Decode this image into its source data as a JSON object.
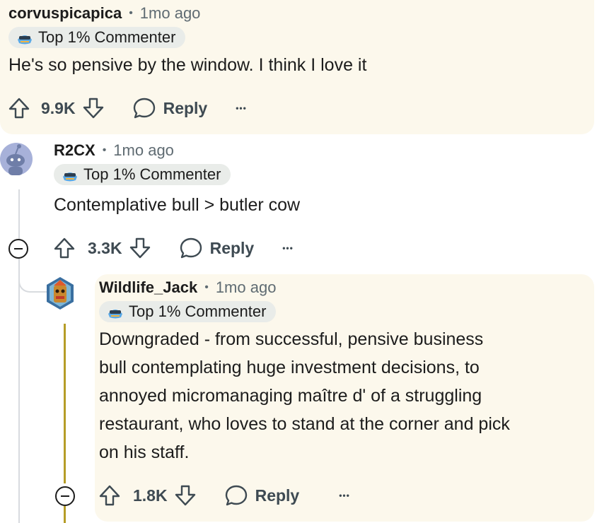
{
  "badge_label": "Top 1% Commenter",
  "comments": [
    {
      "username": "corvuspicapica",
      "separator": "•",
      "time": "1mo ago",
      "text": "He's so pensive by the window. I think I love it",
      "votes": "9.9K",
      "reply_label": "Reply",
      "more_label": "•••"
    },
    {
      "username": "R2CX",
      "separator": "•",
      "time": "1mo ago",
      "text": "Contemplative bull > butler cow",
      "votes": "3.3K",
      "reply_label": "Reply",
      "more_label": "•••"
    },
    {
      "username": "Wildlife_Jack",
      "separator": "•",
      "time": "1mo ago",
      "text_lines": [
        "Downgraded - from successful, pensive business",
        "bull contemplating huge investment decisions, to",
        "annoyed micromanaging maître d' of a struggling",
        "restaurant, who loves to stand at the corner and pick",
        "on his staff."
      ],
      "votes": "1.8K",
      "reply_label": "Reply",
      "more_label": "•••"
    }
  ],
  "colors": {
    "highlight": "#fcf8ec",
    "badge_bg": "#e9ece9",
    "thread_line": "#d8dbdf",
    "gold_line": "#b69d28"
  },
  "icons": [
    "upvote-icon",
    "downvote-icon",
    "reply-bubble-icon",
    "top-commenter-icon",
    "collapse-icon"
  ]
}
